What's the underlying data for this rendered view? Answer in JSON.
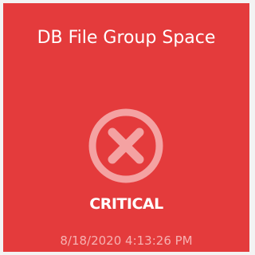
{
  "tile": {
    "title": "DB File Group Space",
    "status": "CRITICAL",
    "timestamp": "8/18/2020 4:13:26 PM",
    "icon": "critical-x-circle-icon",
    "colors": {
      "background": "#e43b3c",
      "text": "#ffffff",
      "icon": "#f4a2a2",
      "timestamp": "#f6b1b1",
      "page_background": "#f3f3f3"
    }
  }
}
